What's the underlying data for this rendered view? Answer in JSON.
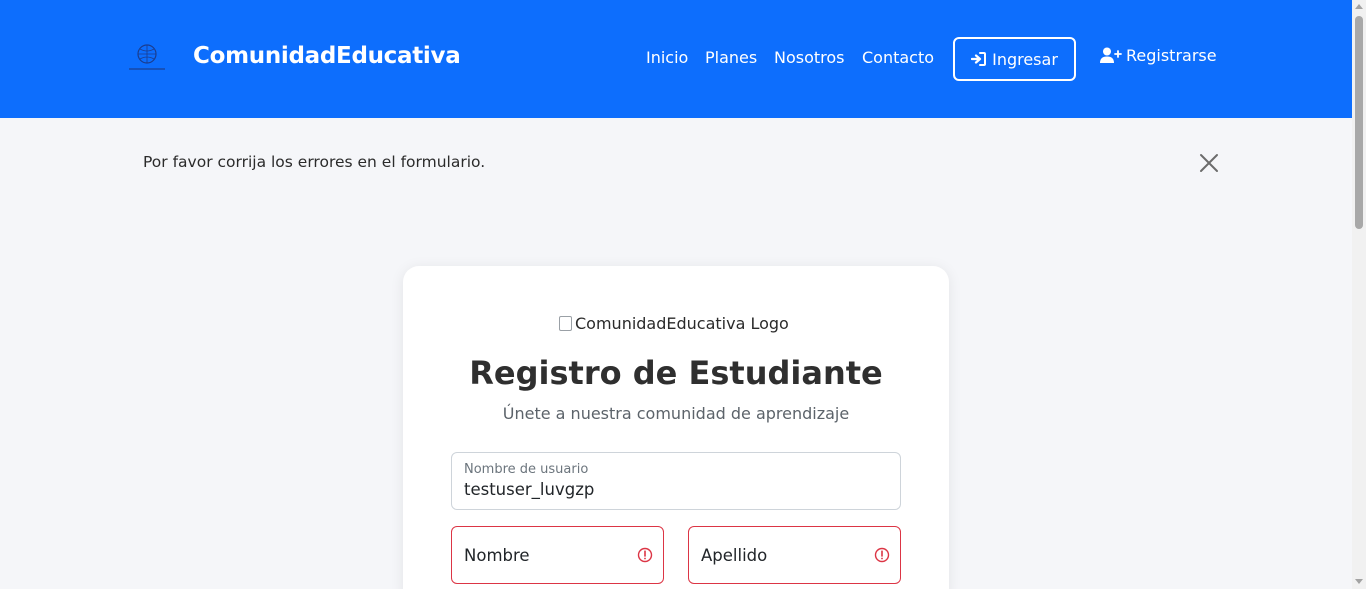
{
  "navbar": {
    "brand": "ComunidadEducativa",
    "links": [
      "Inicio",
      "Planes",
      "Nosotros",
      "Contacto"
    ],
    "login_label": "Ingresar",
    "register_label": "Registrarse",
    "color": "#0d6efd"
  },
  "alert": {
    "message": "Por favor corrija los errores en el formulario."
  },
  "card": {
    "logo_alt": "ComunidadEducativa Logo",
    "title": "Registro de Estudiante",
    "subtitle": "Únete a nuestra comunidad de aprendizaje"
  },
  "form": {
    "username": {
      "label": "Nombre de usuario",
      "value": "testuser_luvgzp"
    },
    "first_name": {
      "placeholder": "Nombre",
      "state": "invalid"
    },
    "last_name": {
      "placeholder": "Apellido",
      "state": "invalid"
    }
  },
  "colors": {
    "error": "#dc3545",
    "text": "#2f2f2f"
  },
  "icons": {
    "login": "sign-in-icon",
    "register": "user-plus-icon",
    "close": "close-icon",
    "error": "exclamation-circle-icon"
  }
}
